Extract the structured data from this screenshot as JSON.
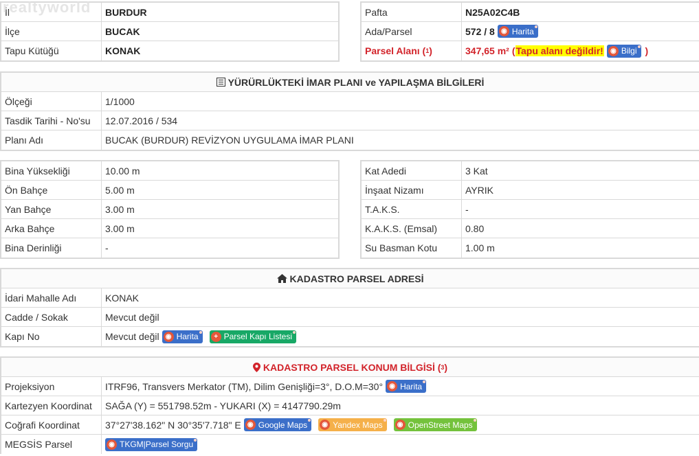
{
  "watermark": "realtyworld",
  "top_left": {
    "rows": [
      {
        "label": "İl",
        "value": "BURDUR"
      },
      {
        "label": "İlçe",
        "value": "BUCAK"
      },
      {
        "label": "Tapu Kütüğü",
        "value": "KONAK"
      }
    ]
  },
  "top_right": {
    "pafta_label": "Pafta",
    "pafta_value": "N25A02C4B",
    "ada_label": "Ada/Parsel",
    "ada_value": "572 / 8",
    "ada_button": "Harita",
    "alan_label": "Parsel Alanı (",
    "alan_sup": "1",
    "alan_label_end": ")",
    "alan_value": "347,65 m²",
    "alan_open": "(",
    "alan_warning": "Tapu alanı değildir!",
    "alan_button": "Bilgi",
    "alan_close": ")"
  },
  "imar": {
    "title": "YÜRÜRLÜKTEKİ İMAR PLANI ve YAPILAŞMA BİLGİLERİ",
    "rows": [
      {
        "label": "Ölçeği",
        "value": "1/1000"
      },
      {
        "label": "Tasdik Tarihi - No'su",
        "value": "12.07.2016 / 534"
      },
      {
        "label": "Planı Adı",
        "value": "BUCAK (BURDUR) REVİZYON UYGULAMA İMAR PLANI"
      }
    ]
  },
  "yapi_left": {
    "rows": [
      {
        "label": "Bina Yüksekliği",
        "value": "10.00 m"
      },
      {
        "label": "Ön Bahçe",
        "value": "5.00 m"
      },
      {
        "label": "Yan Bahçe",
        "value": "3.00 m"
      },
      {
        "label": "Arka Bahçe",
        "value": "3.00 m"
      },
      {
        "label": "Bina Derinliği",
        "value": "-"
      }
    ]
  },
  "yapi_right": {
    "rows": [
      {
        "label": "Kat Adedi",
        "value": "3 Kat"
      },
      {
        "label": "İnşaat Nizamı",
        "value": "AYRIK"
      },
      {
        "label": "T.A.K.S.",
        "value": "-"
      },
      {
        "label": "K.A.K.S. (Emsal)",
        "value": "0.80"
      },
      {
        "label": "Su Basman Kotu",
        "value": "1.00 m"
      }
    ]
  },
  "adres": {
    "title": "KADASTRO PARSEL ADRESİ",
    "rows": [
      {
        "label": "İdari Mahalle Adı",
        "value": "KONAK"
      },
      {
        "label": "Cadde / Sokak",
        "value": "Mevcut değil"
      },
      {
        "label": "Kapı No",
        "value": "Mevcut değil"
      }
    ],
    "harita_button": "Harita",
    "kapi_button": "Parsel Kapı Listesi"
  },
  "konum": {
    "title": "KADASTRO PARSEL KONUM BİLGİSİ (",
    "title_sup": "3",
    "title_end": ")",
    "projeksiyon_label": "Projeksiyon",
    "projeksiyon_value": "ITRF96, Transvers Merkator (TM), Dilim Genişliği=3°, D.O.M=30°",
    "projeksiyon_button": "Harita",
    "kartezyen_label": "Kartezyen Koordinat",
    "kartezyen_value": "SAĞA (Y) = 551798.52m - YUKARI (X) = 4147790.29m",
    "cografi_label": "Coğrafi Koordinat",
    "cografi_value": "37°27'38.162\" N 30°35'7.718\" E",
    "google_button": "Google Maps",
    "yandex_button": "Yandex Maps",
    "osm_button": "OpenStreet Maps",
    "megsis_label": "MEGSİS Parsel",
    "megsis_button": "TKGM|Parsel Sorgu"
  },
  "colors": {
    "accent_red": "#d2232a",
    "button_blue": "#3b6fc9",
    "button_green": "#18a866",
    "button_orange": "#f5b04a",
    "button_lime": "#74c23c",
    "highlight_yellow": "#ffff00",
    "border_gray": "#d9d9d9"
  }
}
